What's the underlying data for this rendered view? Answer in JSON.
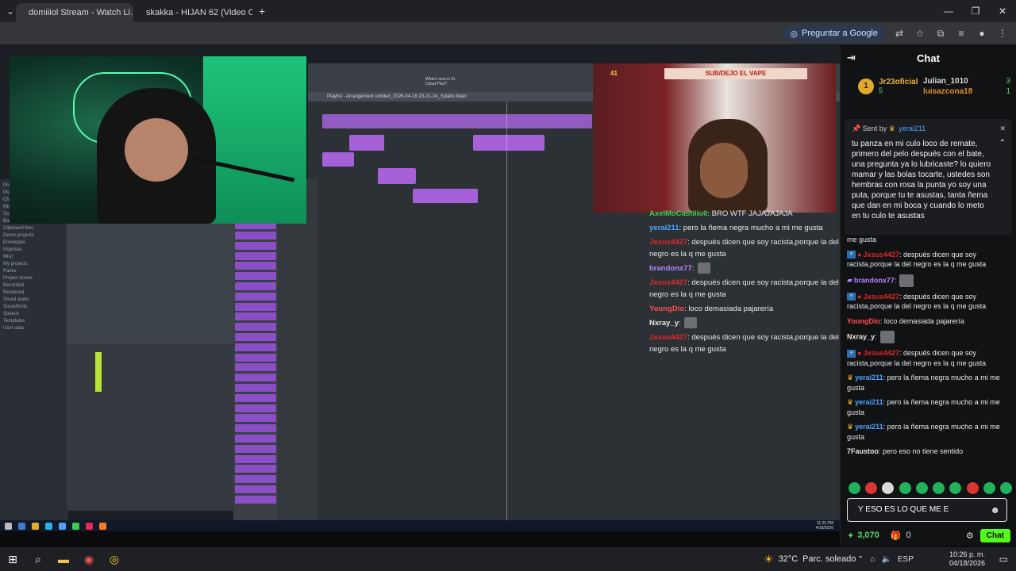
{
  "browser": {
    "tabs": [
      {
        "label": "domiiiol Stream - Watch Li...",
        "active": true,
        "favicon_color": "#53fc18"
      },
      {
        "label": "skakka - HIJAN 62 (Video Ofi...",
        "active": false,
        "favicon_color": "#ff0000"
      }
    ],
    "new_tab": "+",
    "ask_google": "Preguntar a Google"
  },
  "stream": {
    "cam2_banner": "SUB/DEJO EL VAPE",
    "cam2_count": "41",
    "fl_playlist_title": "Playlist - Arrangement  untitled_2026-04-18 23-21-24_Sylatto Main",
    "fl_hint": "What's new in FL Cloud Plus?",
    "fl_browser_items": [
      "Plugin database",
      "Plugin presets",
      "Channel presets",
      "Mixer presets",
      "Scores",
      "Backup",
      "Clipboard files",
      "Demo projects",
      "Envelopes",
      "Impulses",
      "Misc",
      "My projects",
      "Packs",
      "Project bones",
      "Recorded",
      "Rendered",
      "Sliced audio",
      "Soundfonts",
      "Speech",
      "Templates",
      "User data"
    ],
    "overlay_messages": [
      {
        "user": "AxelMoCastillo0",
        "text": ": BRO WTF JAJAJAJAJA",
        "color": "#3ccf4e"
      },
      {
        "user": "yerai211",
        "text": ": pero la ñema negra mucho a mi me gusta",
        "color": "#4aa3ff"
      },
      {
        "user": "Jxsus4427",
        "text": ": después dicen que soy racista,porque la del negro es la q me gusta",
        "color": "#e02929"
      },
      {
        "user": "brandonx77",
        "text": ":",
        "color": "#b784ff"
      },
      {
        "user": "Jxsus4427",
        "text": ": después dicen que soy racista,porque la del negro es la q me gusta",
        "color": "#e02929"
      },
      {
        "user": "YoungDio",
        "text": ": loco demasiada pajarería",
        "color": "#ff4d4d"
      },
      {
        "user": "Nxray_y",
        "text": ":",
        "color": "#e8e8e8"
      },
      {
        "user": "Jxsus4427",
        "text": ": después dicen que soy racista,porque la del negro es la q me gusta",
        "color": "#e02929"
      }
    ]
  },
  "chat": {
    "title": "Chat",
    "leaderboard": {
      "first": {
        "name": "Jr23oficial",
        "rank": "1",
        "count": "5"
      },
      "second": {
        "name": "Julian_1010",
        "count": "3"
      },
      "third": {
        "name": "luisazcona18",
        "count": "1"
      }
    },
    "pinned": {
      "sent_by_label": "Sent by",
      "user": "yerai211",
      "text": "tu panza en mi culo loco de remate, primero del pelo después con el bate, una pregunta ya lo lubricaste? lo quiero mamar y las bolas tocarte, ustedes son hembras con rosa la punta yo soy una puta, porque tu te asustas, tanta ñema que dan en mi boca y cuando lo meto en tu culo te asustas"
    },
    "messages": [
      {
        "user": "",
        "text": "me gusta",
        "color": "#e8e8e8",
        "badge": ""
      },
      {
        "user": "Jxsus4427",
        "text": ": después dicen que soy racista,porque la del negro es la q me gusta",
        "color": "#e02929",
        "badge": "kick"
      },
      {
        "user": "brandonx77",
        "text": ":",
        "color": "#b784ff",
        "badge": "sub"
      },
      {
        "user": "Jxsus4427",
        "text": ": después dicen que soy racista,porque la del negro es la q me gusta",
        "color": "#e02929",
        "badge": "kick"
      },
      {
        "user": "YoungDio",
        "text": ": loco demasiada pajarería",
        "color": "#ff4d4d",
        "badge": ""
      },
      {
        "user": "Nxray_y",
        "text": ":",
        "color": "#e8e8e8",
        "badge": ""
      },
      {
        "user": "Jxsus4427",
        "text": ": después dicen que soy racista,porque la del negro es la q me gusta",
        "color": "#e02929",
        "badge": "kick"
      },
      {
        "user": "yerai211",
        "text": ": pero la ñema negra mucho a mi me gusta",
        "color": "#4aa3ff",
        "badge": "crown"
      },
      {
        "user": "yerai211",
        "text": ": pero la ñema negra mucho a mi me gusta",
        "color": "#4aa3ff",
        "badge": "crown"
      },
      {
        "user": "yerai211",
        "text": ": pero la ñema negra mucho a mi me gusta",
        "color": "#4aa3ff",
        "badge": "crown"
      },
      {
        "user": "7Faustoo",
        "text": ": pero eso no tiene sentido",
        "color": "#e8e8e8",
        "badge": ""
      }
    ],
    "input_value": "Y ESO ES LO QUE ME E",
    "points": "3,070",
    "gifts": "0",
    "send_label": "Chat"
  },
  "remote_clock": {
    "time": "11:25 PM",
    "date": "4/18/2026"
  },
  "taskbar": {
    "weather_temp": "32°C",
    "weather_text": "Parc. soleado",
    "lang": "ESP",
    "time": "10:26 p. m.",
    "date": "04/18/2026"
  }
}
